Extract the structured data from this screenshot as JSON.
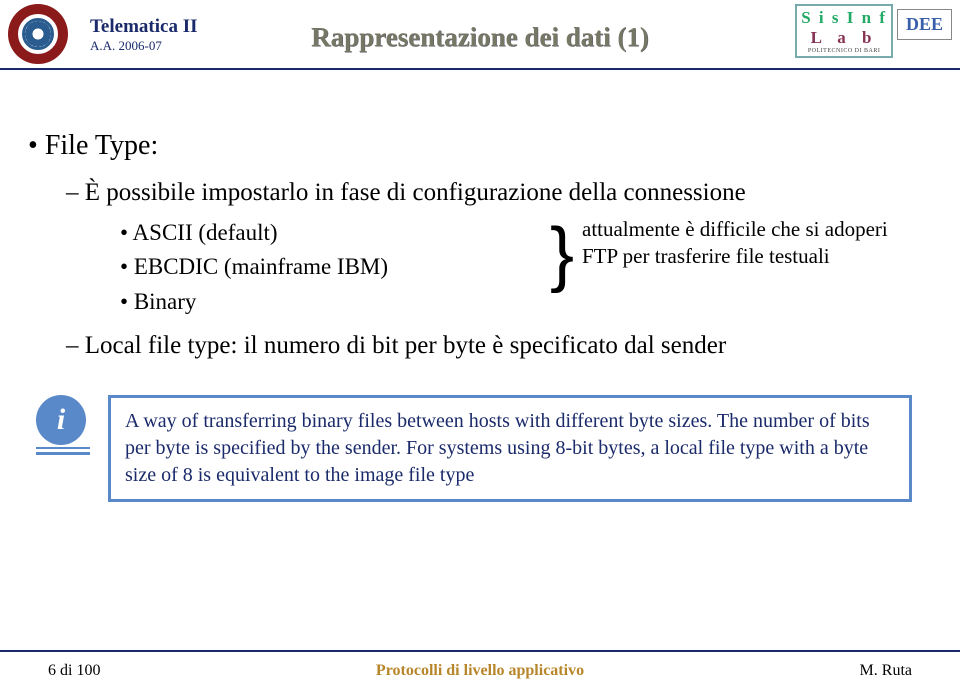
{
  "header": {
    "course": "Telematica II",
    "year": "A.A. 2006-07",
    "title": "Rappresentazione dei dati (1)",
    "brandTop": "S i s I n f",
    "brandBottom": "L a b",
    "brandSub": "POLITECNICO DI BARI",
    "dee": "DEE"
  },
  "content": {
    "main": "File Type:",
    "sub1": "È possibile impostarlo in fase di configurazione della connessione",
    "items": {
      "a": "ASCII (default)",
      "b": "EBCDIC (mainframe IBM)",
      "c": "Binary"
    },
    "note1": "attualmente è difficile che si adoperi",
    "note2": "FTP per trasferire file testuali",
    "sub2": "Local file type: il numero di bit per byte è specificato dal sender",
    "info": "A way of transferring binary files between hosts with different byte sizes. The number of bits per byte is specified by the sender. For systems using 8-bit bytes, a local file type with a byte size of 8 is equivalent to the image file type"
  },
  "footer": {
    "left": "6 di 100",
    "center": "Protocolli di livello applicativo",
    "right": "M. Ruta"
  }
}
